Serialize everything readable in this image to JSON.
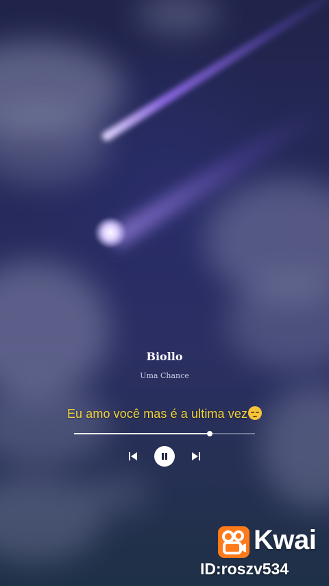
{
  "player": {
    "title": "Biollo",
    "artist": "Uma Chance",
    "lyric": "Eu amo você mas é a ultima vez",
    "lyric_emoji": "pensive-face-emoji",
    "progress": 0.75
  },
  "controls": {
    "previous_icon": "skip-previous-icon",
    "pause_icon": "pause-icon",
    "next_icon": "skip-next-icon"
  },
  "watermark": {
    "brand": "Kwai",
    "id_text": "ID:roszv534",
    "logo_icon": "kwai-camera-logo",
    "logo_color": "#ff7a1a"
  },
  "colors": {
    "lyric": "#f2d23a",
    "meteor": "#9b7cf0"
  }
}
